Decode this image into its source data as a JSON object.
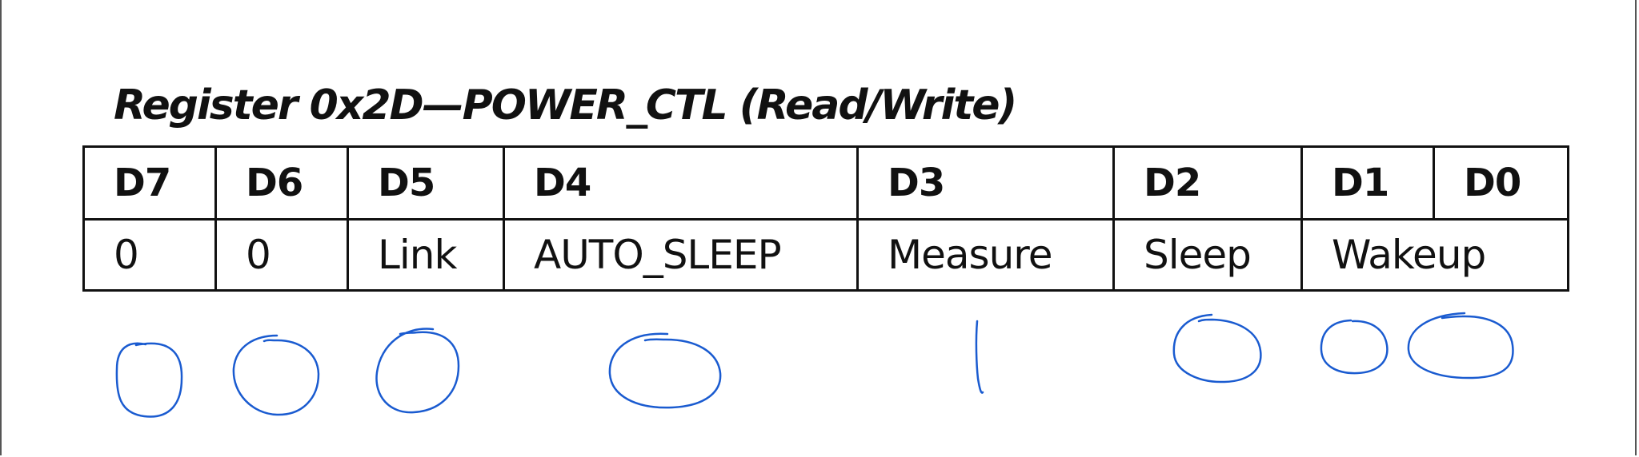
{
  "title": "Register 0x2D—POWER_CTL (Read/Write)",
  "bits": [
    "D7",
    "D6",
    "D5",
    "D4",
    "D3",
    "D2",
    "D1",
    "D0"
  ],
  "fields": [
    "0",
    "0",
    "Link",
    "AUTO_SLEEP",
    "Measure",
    "Sleep",
    "Wakeup"
  ],
  "annotations": {
    "color": "#1a5bd0",
    "marks": [
      "circle",
      "circle",
      "circle",
      "circle",
      "line",
      "circle",
      "circle",
      "circle"
    ]
  }
}
